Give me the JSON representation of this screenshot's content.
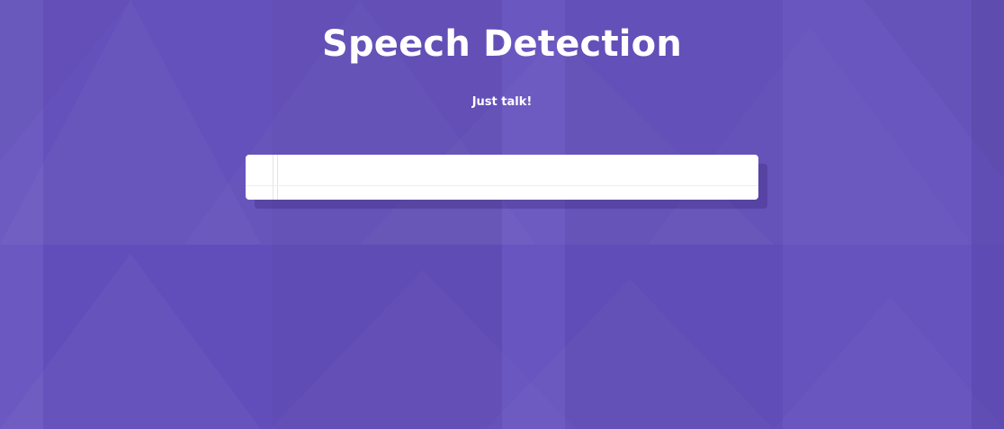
{
  "page": {
    "title": "Speech Detection",
    "subtitle": "Just talk!"
  },
  "transcript": {
    "paragraphs": [
      ""
    ]
  },
  "colors": {
    "background": "#6450bd",
    "text": "#ffffff",
    "paper": "#ffffff",
    "paper_margin_line": "#ebe2e2"
  }
}
